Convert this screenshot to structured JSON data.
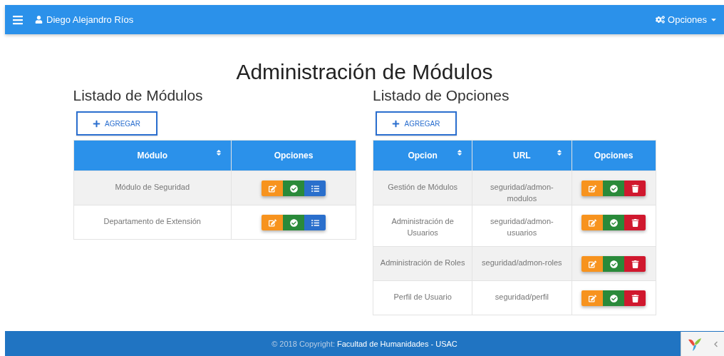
{
  "navbar": {
    "user": "Diego Alejandro Ríos",
    "menu": "Opciones"
  },
  "title": "Administración de Módulos",
  "panels": [
    {
      "heading": "Listado de Módulos",
      "add_button": "AGREGAR",
      "columns": [
        {
          "label": "Módulo",
          "sortable": true
        },
        {
          "label": "Opciones",
          "sortable": false
        }
      ],
      "rows": [
        {
          "cells": [
            "Módulo de Seguridad"
          ],
          "actions": [
            {
              "kind": "edit",
              "color": "#f7931e"
            },
            {
              "kind": "check",
              "color": "#2a8a3a"
            },
            {
              "kind": "list",
              "color": "#2a6fcc"
            }
          ]
        },
        {
          "cells": [
            "Departamento de Extensión"
          ],
          "actions": [
            {
              "kind": "edit",
              "color": "#f7931e"
            },
            {
              "kind": "check",
              "color": "#2a8a3a"
            },
            {
              "kind": "list",
              "color": "#2a6fcc"
            }
          ]
        }
      ]
    },
    {
      "heading": "Listado de Opciones",
      "add_button": "AGREGAR",
      "columns": [
        {
          "label": "Opcion",
          "sortable": true
        },
        {
          "label": "URL",
          "sortable": true
        },
        {
          "label": "Opciones",
          "sortable": false
        }
      ],
      "rows": [
        {
          "cells": [
            "Gestión de Módulos",
            "seguridad/admon-modulos"
          ],
          "actions": [
            {
              "kind": "edit",
              "color": "#f7931e"
            },
            {
              "kind": "check",
              "color": "#2a8a3a"
            },
            {
              "kind": "delete",
              "color": "#d0182e"
            }
          ]
        },
        {
          "cells": [
            "Administración de Usuarios",
            "seguridad/admon-usuarios"
          ],
          "actions": [
            {
              "kind": "edit",
              "color": "#f7931e"
            },
            {
              "kind": "check",
              "color": "#2a8a3a"
            },
            {
              "kind": "delete",
              "color": "#d0182e"
            }
          ]
        },
        {
          "cells": [
            "Administración de Roles",
            "seguridad/admon-roles"
          ],
          "actions": [
            {
              "kind": "edit",
              "color": "#f7931e"
            },
            {
              "kind": "check",
              "color": "#2a8a3a"
            },
            {
              "kind": "delete",
              "color": "#d0182e"
            }
          ]
        },
        {
          "cells": [
            "Perfil de Usuario",
            "seguridad/perfil"
          ],
          "actions": [
            {
              "kind": "edit",
              "color": "#f7931e"
            },
            {
              "kind": "check",
              "color": "#2a8a3a"
            },
            {
              "kind": "delete",
              "color": "#d0182e"
            }
          ]
        }
      ]
    }
  ],
  "footer": {
    "copyright": "© 2018 Copyright:",
    "link": "Facultad de Humanidades - USAC"
  }
}
